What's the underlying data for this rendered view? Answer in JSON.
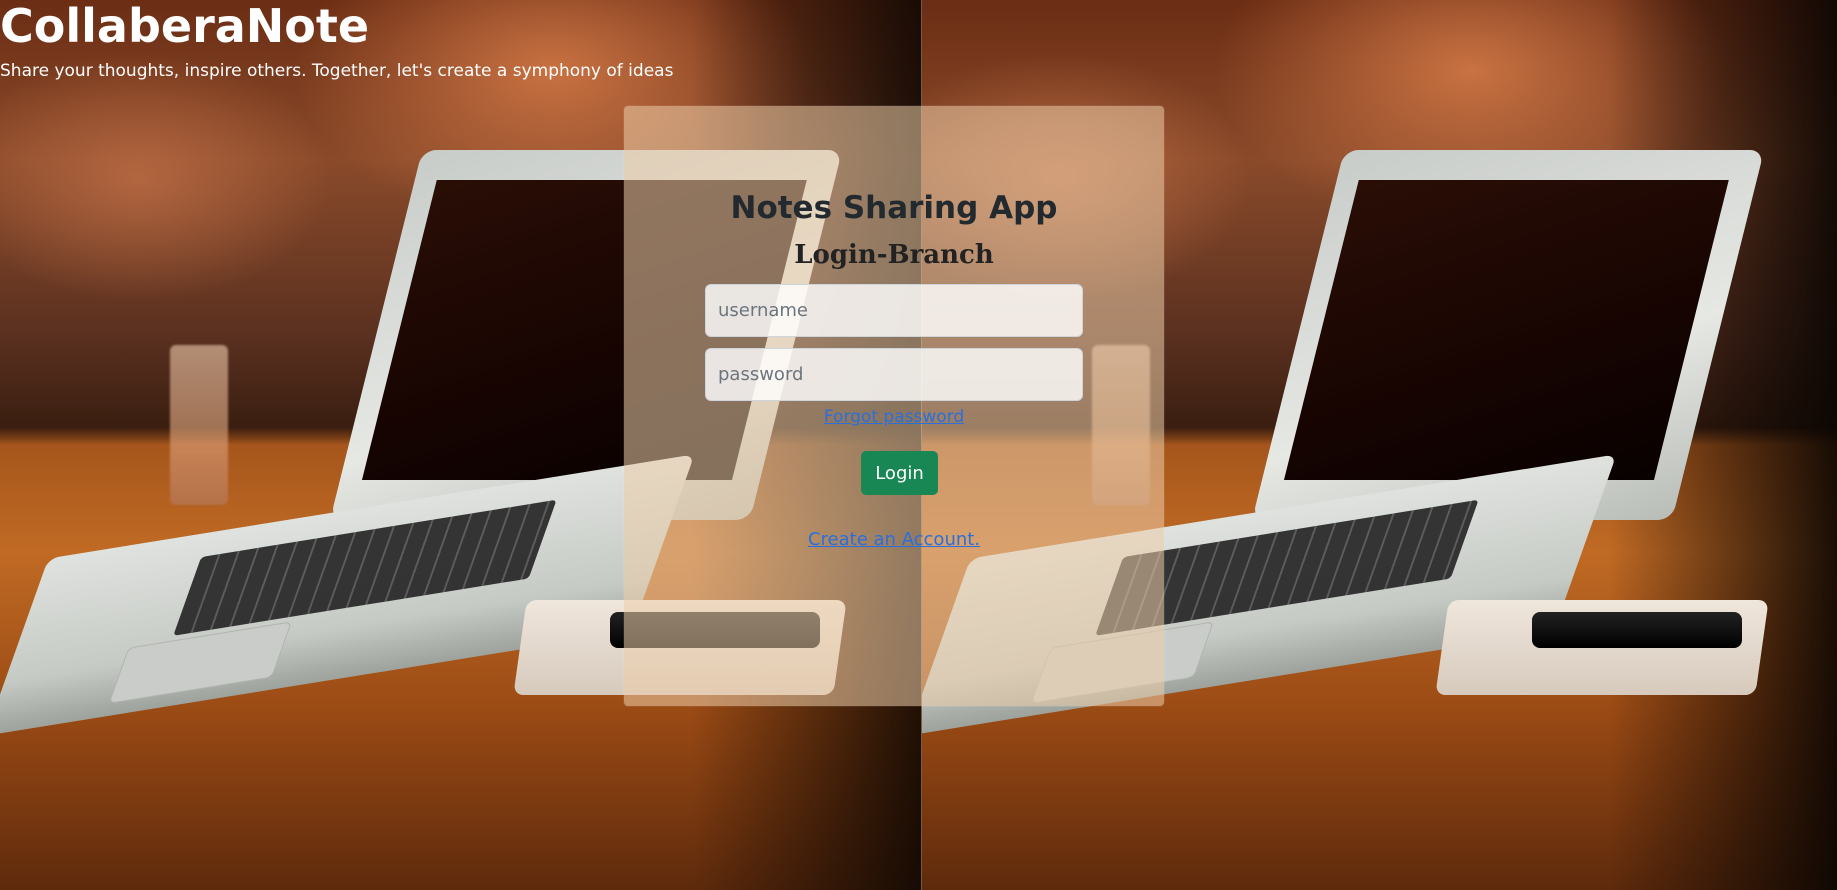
{
  "header": {
    "brand": "CollaberaNote",
    "tagline": "Share your thoughts, inspire others. Together, let's create a symphony of ideas"
  },
  "login_card": {
    "title": "Notes Sharing App",
    "subtitle": "Login-Branch",
    "username_placeholder": "username",
    "username_value": "",
    "password_placeholder": "password",
    "password_value": "",
    "forgot_password_label": "Forgot password",
    "login_button_label": "Login",
    "create_account_label": "Create an Account."
  },
  "colors": {
    "login_button": "#198754",
    "link": "#2a6fdb",
    "card_background": "rgba(236, 205, 170, 0.55)"
  },
  "background": {
    "description_icon": "laptop-on-table-photo"
  }
}
